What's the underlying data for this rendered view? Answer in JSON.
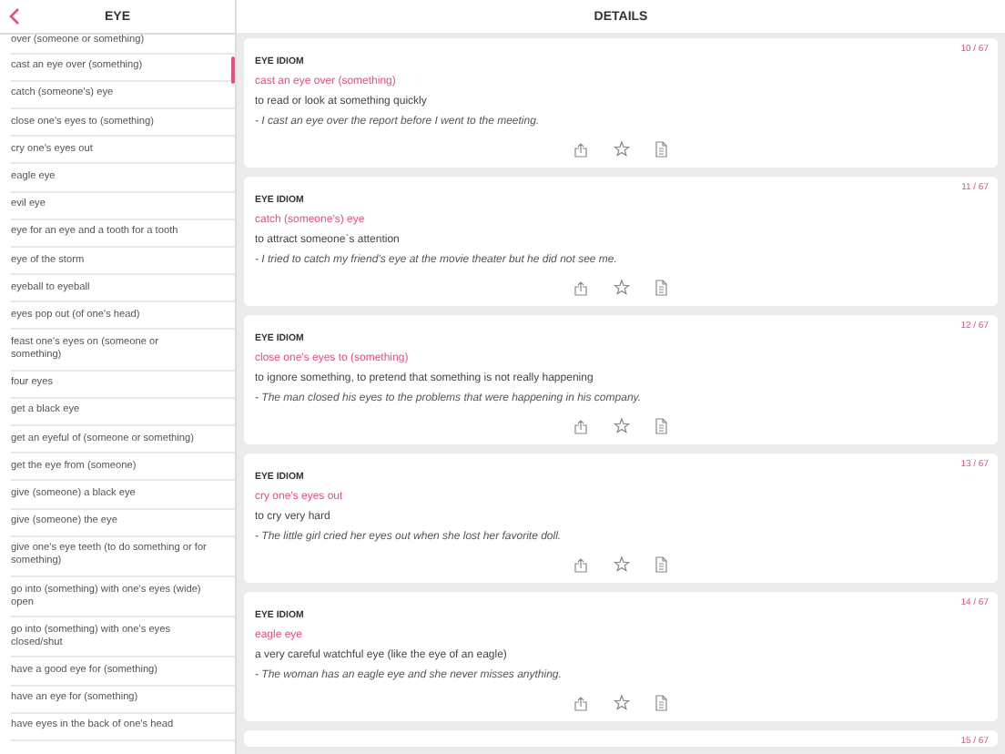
{
  "sidebar": {
    "title": "EYE",
    "items": [
      {
        "label": "over (someone or something)"
      },
      {
        "label": "cast an eye over (something)"
      },
      {
        "label": "catch (someone's) eye"
      },
      {
        "label": "close one's eyes to (something)"
      },
      {
        "label": "cry one's eyes out"
      },
      {
        "label": "eagle eye"
      },
      {
        "label": "evil eye"
      },
      {
        "label": "eye for an eye and a tooth for a tooth"
      },
      {
        "label": "eye of the storm"
      },
      {
        "label": "eyeball to eyeball"
      },
      {
        "label": "eyes pop out (of one's head)"
      },
      {
        "label": "feast one's eyes on (someone or something)"
      },
      {
        "label": "four eyes"
      },
      {
        "label": "get a black eye"
      },
      {
        "label": "get an eyeful of (someone or something)"
      },
      {
        "label": "get the eye from (someone)"
      },
      {
        "label": "give (someone) a black eye"
      },
      {
        "label": "give (someone) the eye"
      },
      {
        "label": "give one's eye teeth (to do something or for something)"
      },
      {
        "label": "go into (something) with one's eyes (wide) open"
      },
      {
        "label": "go into (something) with one's eyes closed/shut"
      },
      {
        "label": "have a good eye for (something)"
      },
      {
        "label": "have an eye for (something)"
      },
      {
        "label": "have eyes in the back of one's head"
      }
    ]
  },
  "details": {
    "title": "DETAILS",
    "cards": [
      {
        "counter": "10 / 67",
        "category": "EYE IDIOM",
        "idiom": "cast an eye over (something)",
        "definition": "to read or look at something quickly",
        "example": "- I cast an eye over the report before I went to the meeting."
      },
      {
        "counter": "11 / 67",
        "category": "EYE IDIOM",
        "idiom": "catch (someone's) eye",
        "definition": "to attract someone`s attention",
        "example": "- I tried to catch my friend's eye at the movie theater but he did not see me."
      },
      {
        "counter": "12 / 67",
        "category": "EYE IDIOM",
        "idiom": "close one's eyes to (something)",
        "definition": "to ignore something, to pretend that something is not really happening",
        "example": "- The man closed his eyes to the problems that were happening in his company."
      },
      {
        "counter": "13 / 67",
        "category": "EYE IDIOM",
        "idiom": "cry one's eyes out",
        "definition": "to cry very hard",
        "example": "- The little girl cried her eyes out when she lost her favorite doll."
      },
      {
        "counter": "14 / 67",
        "category": "EYE IDIOM",
        "idiom": "eagle eye",
        "definition": "a very careful watchful eye (like the eye of an eagle)",
        "example": "- The woman has an eagle eye and she never misses anything."
      },
      {
        "counter": "15 / 67"
      }
    ]
  }
}
